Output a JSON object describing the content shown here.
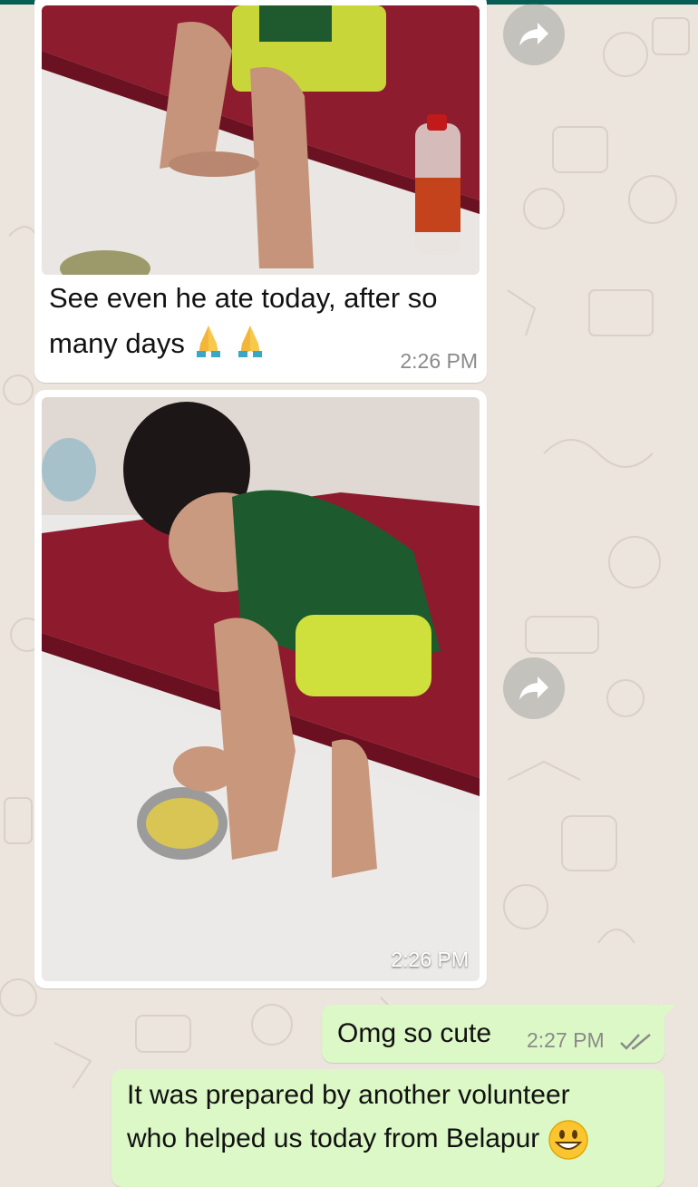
{
  "messages": [
    {
      "direction": "incoming",
      "type": "image",
      "image_desc": "child sitting on red mattress",
      "caption": "See even he ate today, after so many days",
      "caption_emoji": "folded-hands x2",
      "time": "2:26 PM"
    },
    {
      "direction": "incoming",
      "type": "image",
      "image_desc": "child in green shirt eating from steel bowl",
      "time": "2:26 PM"
    },
    {
      "direction": "outgoing",
      "type": "text",
      "text": "Omg so cute",
      "time": "2:27 PM",
      "status": "read"
    },
    {
      "direction": "outgoing",
      "type": "text",
      "text_line1": "It was prepared by another volunteer",
      "text_line2": "who helped us today from Belapur",
      "emoji": "grinning-face"
    }
  ],
  "colors": {
    "header": "#075e54",
    "wallpaper": "#ece5dd",
    "incoming_bubble": "#ffffff",
    "outgoing_bubble": "#dcf8c6",
    "read_tick": "#8a8a8a"
  },
  "icons": [
    "forward-icon",
    "folded-hands-emoji",
    "grinning-face-emoji",
    "double-check-icon"
  ]
}
